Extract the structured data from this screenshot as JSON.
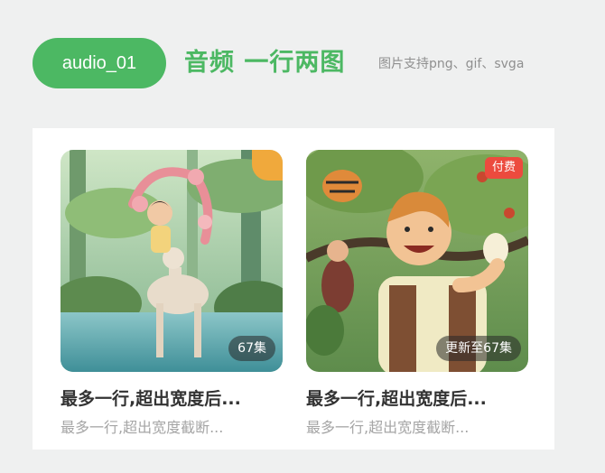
{
  "header": {
    "pill_label": "audio_01",
    "title": "音频 一行两图",
    "subtitle": "图片支持png、gif、svga"
  },
  "cards": [
    {
      "badge": "67集",
      "title": "最多一行,超出宽度后...",
      "subtitle": "最多一行,超出宽度截断..."
    },
    {
      "tag": "付费",
      "badge": "更新至67集",
      "title": "最多一行,超出宽度后...",
      "subtitle": "最多一行,超出宽度截断..."
    }
  ],
  "colors": {
    "accent": "#4cb863",
    "pay_tag": "#ec4b3e",
    "background": "#eff0f0",
    "panel": "#ffffff"
  }
}
